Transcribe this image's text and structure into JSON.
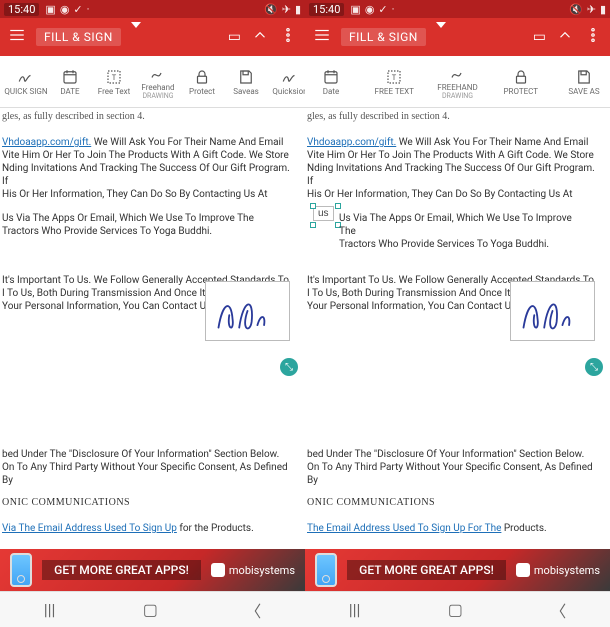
{
  "status": {
    "time": "15:40",
    "left_icons": [
      "image-icon",
      "sync-icon",
      "check-icon",
      "dot-icon"
    ],
    "right_icons": [
      "mute-icon",
      "airplane-icon",
      "battery-icon"
    ]
  },
  "appbar": {
    "title": "FILL & SIGN"
  },
  "toolbar_left": [
    {
      "id": "quicksign",
      "label": "QUICK SIGN",
      "sub": ""
    },
    {
      "id": "date",
      "label": "DATE",
      "sub": ""
    },
    {
      "id": "freetext",
      "label": "Free Text",
      "sub": ""
    },
    {
      "id": "freehand",
      "label": "Freehand",
      "sub": "DRAWING"
    },
    {
      "id": "protect",
      "label": "Protect",
      "sub": ""
    },
    {
      "id": "saveas",
      "label": "Saveas",
      "sub": ""
    },
    {
      "id": "quicksion",
      "label": "Quicksion",
      "sub": ""
    }
  ],
  "toolbar_right": [
    {
      "id": "date2",
      "label": "Date",
      "sub": ""
    },
    {
      "id": "freetext2",
      "label": "FREE TEXT",
      "sub": ""
    },
    {
      "id": "freehand2",
      "label": "FREEHAND",
      "sub": "DRAWING"
    },
    {
      "id": "protect2",
      "label": "PROTECT",
      "sub": ""
    },
    {
      "id": "saveas2",
      "label": "SAVE AS",
      "sub": ""
    }
  ],
  "doc": {
    "strip": "gles, as fully described in section 4.",
    "b1_link": "Vhdoaapp.com/gift.",
    "b1_rest": " We Will Ask You For Their Name And Email",
    "b1_l2": "Vite Him Or Her To Join The Products With A Gift Code. We Store",
    "b1_l3": "Nding Invitations And Tracking The Success Of Our Gift Program. If",
    "b1_l4": "His Or Her Information, They Can Do So By Contacting Us At",
    "b2_l1": "Us Via The Apps Or Email, Which We Use To Improve The",
    "b2_l2": "Tractors Who Provide Services To Yoga Buddhi.",
    "b3_l1": "It's Important To Us. We Follow Generally Accepted Standards To",
    "b3_l2": "I To Us, Both During Transmission And Once It Is Received. If You",
    "b3_l3": "Your Personal Information, You Can Contact Us At",
    "b4_l1": "bed Under The \"Disclosure Of Your Information\" Section Below.",
    "b4_l2": "On To Any Third Party Without Your Specific Consent, As Defined By",
    "b5": "ONIC COMMUNICATIONS",
    "b6_link_l": "Via The Email Address Used To Sign Up",
    "b6_rest_l": " for the Products.",
    "b6_link_r": "The Email Address Used To Sign Up For The",
    "b6_rest_r": " Products.",
    "us_box": "us"
  },
  "ad": {
    "msg": "GET MORE GREAT APPS!",
    "brand": "mobisystems"
  }
}
